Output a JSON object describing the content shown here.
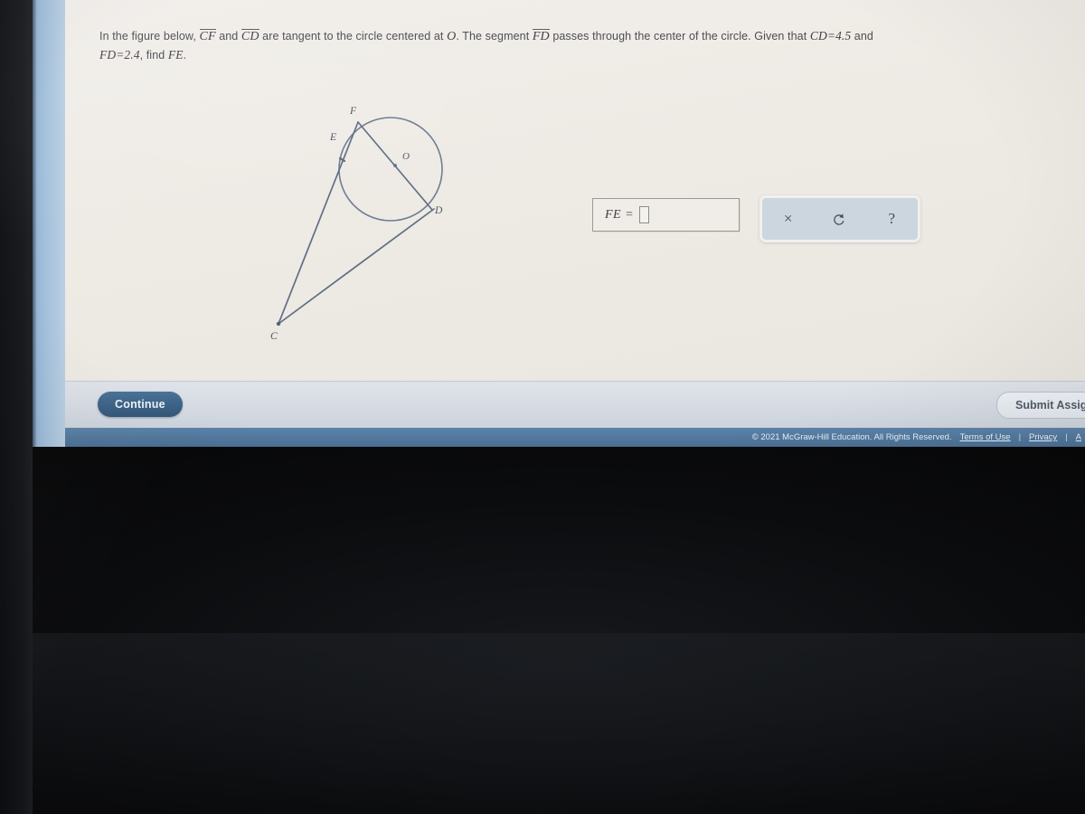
{
  "prompt": {
    "part1": "In the figure below,",
    "seg_cf": "CF",
    "and1": "and",
    "seg_cd": "CD",
    "part2": "are tangent to the circle centered at",
    "point_o": "O",
    "part3": ". The segment",
    "seg_fd": "FD",
    "part4": "passes through the center of the circle. Given that",
    "given_cd": "CD=4.5",
    "and2": "and",
    "given_fd": "FD=2.4",
    "part5": ", find",
    "find_fe": "FE",
    "period": "."
  },
  "figure": {
    "labels": {
      "F": "F",
      "E": "E",
      "O": "O",
      "D": "D",
      "C": "C"
    },
    "stroke_color": "#5b6b82"
  },
  "answer": {
    "label": "FE =",
    "value": "",
    "placeholder": ""
  },
  "toolbar": {
    "clear_icon": "×",
    "undo_icon": "undo-arrow",
    "help_icon": "?"
  },
  "actions": {
    "continue_label": "Continue",
    "submit_label": "Submit Assignment"
  },
  "footer": {
    "copyright": "© 2021 McGraw-Hill Education. All Rights Reserved.",
    "terms": "Terms of Use",
    "sep1": "|",
    "privacy": "Privacy",
    "sep2": "|",
    "accessibility": "A"
  },
  "colors": {
    "page_bg": "#eeeae5",
    "accent_blue": "#3b6186",
    "footer_blue": "#4e76a0",
    "toolbar_bg": "#ccd6de"
  }
}
